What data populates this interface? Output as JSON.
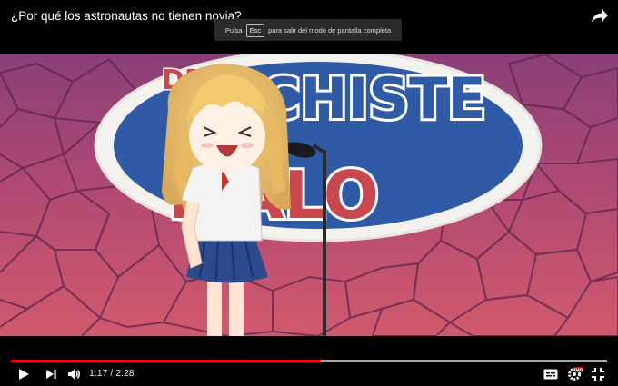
{
  "video": {
    "title": "¿Por qué los astronautas no tienen novia?",
    "progress_played_fraction": 0.52,
    "progress_loaded_fraction": 1.0
  },
  "fullscreen_notice": {
    "prefix": "Pulsa",
    "key": "Esc",
    "suffix": "para salir del modo de pantalla completa"
  },
  "player_controls": {
    "current_time": "1:17",
    "separator": "/",
    "duration": "2:28",
    "time_display": "1:17 / 2:28",
    "hd_badge": "HD",
    "icons": [
      "play-icon",
      "next-icon",
      "volume-icon",
      "subtitles-icon",
      "settings-icon",
      "exit-fullscreen-icon",
      "share-icon"
    ]
  },
  "video_frame": {
    "sign_top_text": "DEL",
    "sign_line1": "CHISTE",
    "sign_line2": "MALO"
  },
  "colors": {
    "progress_played": "#ff0000",
    "wall_base": "#b5486e",
    "sign_blue": "#2f5aa6",
    "sign_red": "#c9484f"
  }
}
